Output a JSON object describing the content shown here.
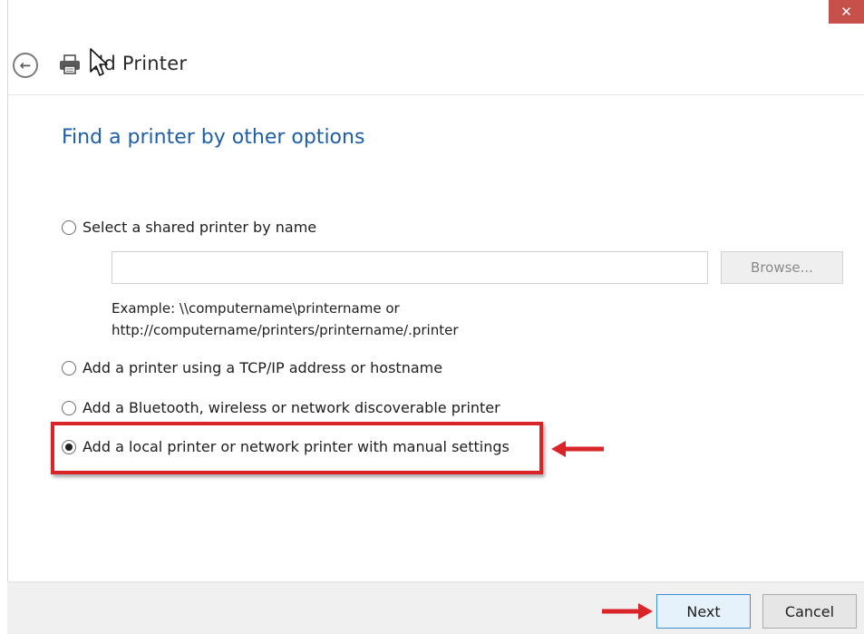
{
  "window": {
    "title": "Add Printer",
    "close_label": "✕"
  },
  "header": {
    "back_icon": "back-arrow-icon",
    "printer_icon": "printer-icon",
    "title": "dd Printer"
  },
  "main": {
    "heading": "Find a printer by other options",
    "options": [
      {
        "label": "Select a shared printer by name",
        "selected": false
      },
      {
        "label": "Add a printer using a TCP/IP address or hostname",
        "selected": false
      },
      {
        "label": "Add a Bluetooth, wireless or network discoverable printer",
        "selected": false
      },
      {
        "label": "Add a local printer or network printer with manual settings",
        "selected": true
      }
    ],
    "printer_name": {
      "value": "",
      "placeholder": ""
    },
    "browse_label": "Browse...",
    "example_line1": "Example: \\\\computername\\printername or",
    "example_line2": "http://computername/printers/printername/.printer"
  },
  "footer": {
    "next_label": "Next",
    "cancel_label": "Cancel"
  },
  "colors": {
    "heading": "#1f5fa8",
    "annotation_red": "#d9252a",
    "close_button": "#c7504a"
  }
}
